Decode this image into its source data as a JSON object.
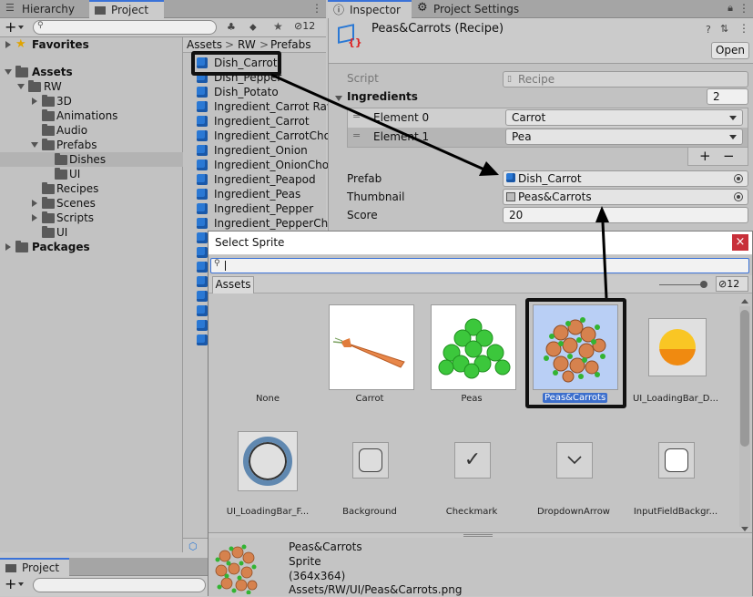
{
  "tabs": {
    "hierarchy": "Hierarchy",
    "project": "Project",
    "inspector": "Inspector",
    "project_settings": "Project Settings",
    "bottom_project": "Project"
  },
  "project_toolbar": {
    "add_label": "+",
    "hidden_count": "12"
  },
  "tree": {
    "favorites": "Favorites",
    "assets": "Assets",
    "rw": "RW",
    "d3": "3D",
    "animations": "Animations",
    "audio": "Audio",
    "prefabs": "Prefabs",
    "dishes": "Dishes",
    "ui": "UI",
    "recipes": "Recipes",
    "scenes": "Scenes",
    "scripts": "Scripts",
    "ui2": "UI",
    "packages": "Packages"
  },
  "breadcrumb": {
    "assets": "Assets",
    "rw": "RW",
    "prefabs": "Prefabs",
    "sep": ">"
  },
  "asset_list": [
    "Dish_Carrot",
    "Dish_Pepper",
    "Dish_Potato",
    "Ingredient_Carrot Raw",
    "Ingredient_Carrot",
    "Ingredient_CarrotChop",
    "Ingredient_Onion",
    "Ingredient_OnionChop",
    "Ingredient_Peapod",
    "Ingredient_Peas",
    "Ingredient_Pepper",
    "Ingredient_PepperCho"
  ],
  "inspector": {
    "title": "Peas&Carrots (Recipe)",
    "open_button": "Open",
    "script_label": "Script",
    "script_value": "Recipe",
    "ingredients_label": "Ingredients",
    "ingredients_count": "2",
    "element0_label": "Element 0",
    "element0_value": "Carrot",
    "element1_label": "Element 1",
    "element1_value": "Pea",
    "add_button": "+",
    "remove_button": "−",
    "prefab_label": "Prefab",
    "prefab_value": "Dish_Carrot",
    "thumbnail_label": "Thumbnail",
    "thumbnail_value": "Peas&Carrots",
    "score_label": "Score",
    "score_value": "20"
  },
  "select_sprite": {
    "title": "Select Sprite",
    "close": "×",
    "search_value": "",
    "assets_tab": "Assets",
    "hidden_count": "12",
    "items": [
      {
        "label": "None",
        "icon": "none"
      },
      {
        "label": "Carrot",
        "icon": "carrot-sprite"
      },
      {
        "label": "Peas",
        "icon": "peas-sprite"
      },
      {
        "label": "Peas&Carrots",
        "icon": "peas-carrots-sprite"
      },
      {
        "label": "UI_LoadingBar_D...",
        "icon": "loadingbar-dot-sprite"
      },
      {
        "label": "UI_LoadingBar_F...",
        "icon": "loadingbar-frame-sprite"
      },
      {
        "label": "Background",
        "icon": "background-sprite"
      },
      {
        "label": "Checkmark",
        "icon": "checkmark-sprite"
      },
      {
        "label": "DropdownArrow",
        "icon": "dropdown-arrow-sprite"
      },
      {
        "label": "InputFieldBackgr...",
        "icon": "inputfield-background-sprite"
      }
    ],
    "preview": {
      "name": "Peas&Carrots",
      "type": "Sprite",
      "size": "(364x364)",
      "path": "Assets/RW/UI/Peas&Carrots.png"
    }
  },
  "colors": {
    "accent": "#3a72d8",
    "cube_blue": "#2a78d4",
    "selection": "#3d6fcc",
    "close_red": "#c8303a"
  }
}
